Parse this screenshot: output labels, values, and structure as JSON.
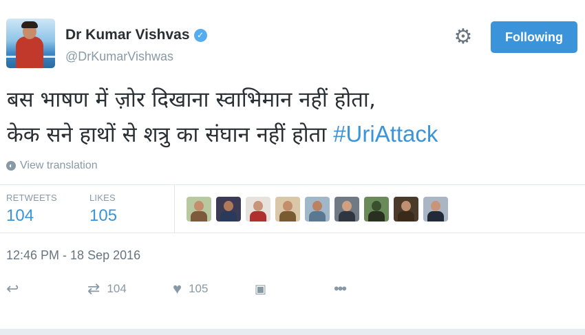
{
  "user": {
    "name": "Dr Kumar Vishvas",
    "handle": "@DrKumarVishwas",
    "verified_icon": "verified-badge-icon"
  },
  "header": {
    "settings_icon": "gear-icon",
    "follow_button_label": "Following"
  },
  "tweet": {
    "line1": "बस भाषण में ज़ोर दिखाना स्वाभिमान नहीं होता,",
    "line2": "केक सने हाथों से शत्रु का संघान नहीं होता",
    "hashtag": "#UriAttack"
  },
  "translate": {
    "icon": "globe-icon",
    "label": "View translation"
  },
  "stats": {
    "retweets_label": "RETWEETS",
    "retweets_value": "104",
    "likes_label": "LIKES",
    "likes_value": "105"
  },
  "liker_avatars": [
    {
      "bg": "#b8c9a0",
      "head": "#c48d6c",
      "body": "#7d5a3c"
    },
    {
      "bg": "#3b3b55",
      "head": "#b07a5a",
      "body": "#2a3a5a"
    },
    {
      "bg": "#e8e2dc",
      "head": "#c9957a",
      "body": "#b03030"
    },
    {
      "bg": "#d9c7a8",
      "head": "#c48d6c",
      "body": "#7a5a30"
    },
    {
      "bg": "#9fb7c9",
      "head": "#b98263",
      "body": "#5a7890"
    },
    {
      "bg": "#6f7a86",
      "head": "#d0a080",
      "body": "#2f3640"
    },
    {
      "bg": "#6a8a5a",
      "head": "#3a4f2f",
      "body": "#2a3020"
    },
    {
      "bg": "#4a3a2a",
      "head": "#c09070",
      "body": "#3a2a1a"
    },
    {
      "bg": "#aab6c4",
      "head": "#c9957a",
      "body": "#222a3a"
    }
  ],
  "timestamp": "12:46 PM - 18 Sep 2016",
  "actions": {
    "reply_icon": "reply-icon",
    "retweet_icon": "retweet-icon",
    "retweet_count": "104",
    "like_icon": "heart-icon",
    "like_count": "105",
    "moment_icon": "moment-icon",
    "more_icon": "more-icon"
  },
  "colors": {
    "accent": "#3b94d9",
    "muted": "#8899a6",
    "text": "#292f33"
  }
}
